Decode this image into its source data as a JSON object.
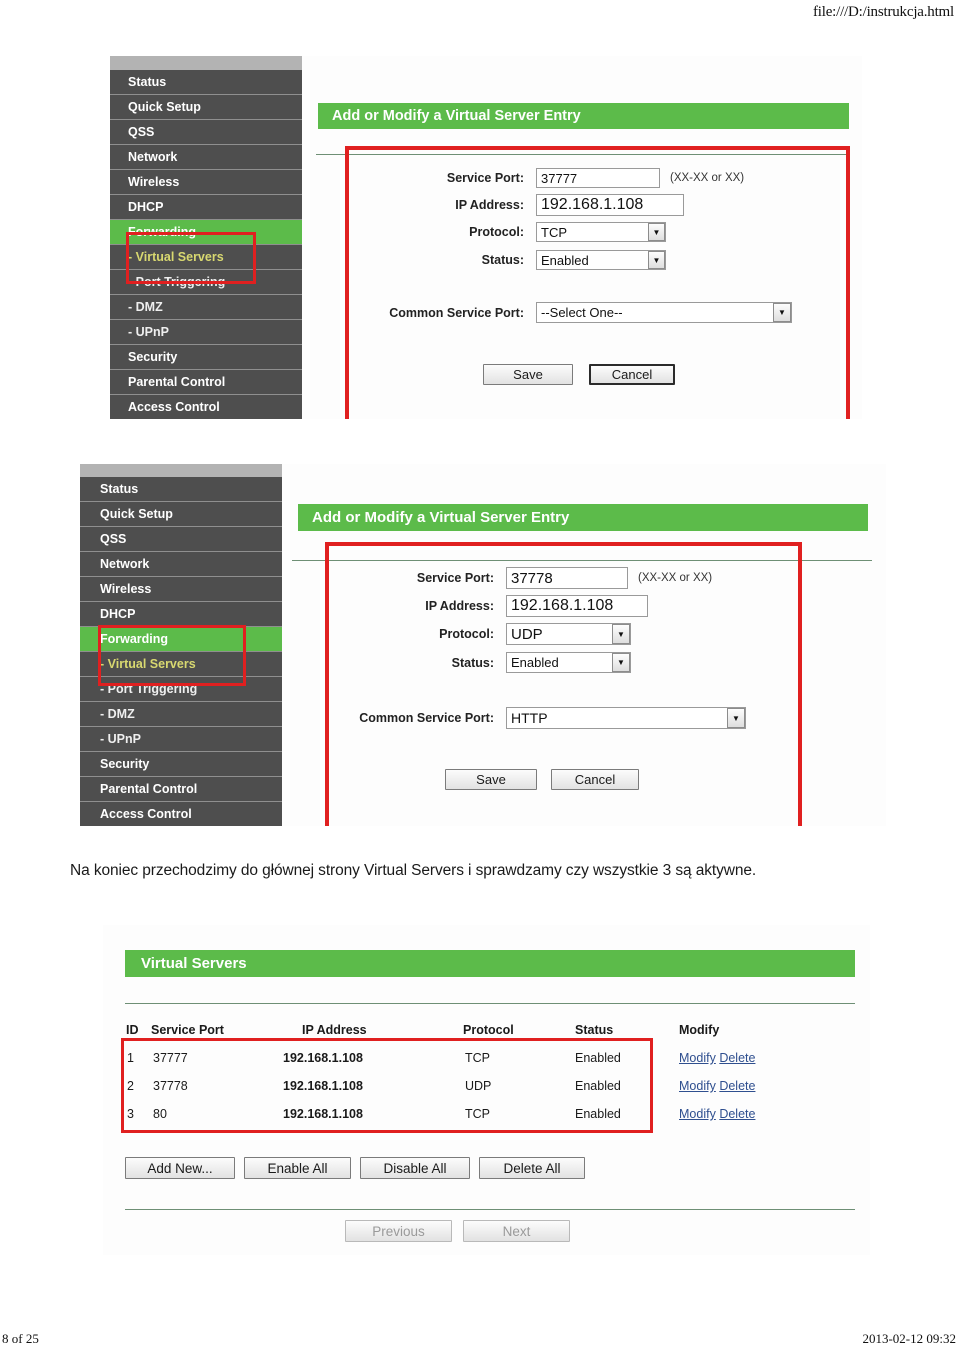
{
  "document": {
    "header_path": "file:///D:/instrukcja.html",
    "footer_page": "8 of 25",
    "footer_timestamp": "2013-02-12 09:32",
    "paragraph": "Na koniec przechodzimy do głównej strony Virtual Servers i sprawdzamy czy wszystkie 3 są aktywne."
  },
  "colors": {
    "accent_green": "#5cbb4a",
    "sidebar_dark": "#4e4e4e",
    "annotation_red": "#e02020",
    "sub_item_highlight": "#d8d870"
  },
  "sidebar": {
    "items": [
      {
        "label": "Status",
        "type": "top"
      },
      {
        "label": "Quick Setup",
        "type": "top"
      },
      {
        "label": "QSS",
        "type": "top"
      },
      {
        "label": "Network",
        "type": "top"
      },
      {
        "label": "Wireless",
        "type": "top"
      },
      {
        "label": "DHCP",
        "type": "top"
      },
      {
        "label": "Forwarding",
        "type": "active"
      },
      {
        "label": "- Virtual Servers",
        "type": "active-sub"
      },
      {
        "label": "- Port Triggering",
        "type": "sub"
      },
      {
        "label": "- DMZ",
        "type": "sub"
      },
      {
        "label": "- UPnP",
        "type": "sub"
      },
      {
        "label": "Security",
        "type": "top"
      },
      {
        "label": "Parental Control",
        "type": "top"
      },
      {
        "label": "Access Control",
        "type": "top"
      }
    ]
  },
  "screenshot_one": {
    "panel_title": "Add or Modify a Virtual Server Entry",
    "fields": {
      "service_port_label": "Service Port:",
      "service_port_value": "37777",
      "service_port_hint": "(XX-XX or XX)",
      "ip_address_label": "IP Address:",
      "ip_address_value": "192.168.1.108",
      "protocol_label": "Protocol:",
      "protocol_value": "TCP",
      "status_label": "Status:",
      "status_value": "Enabled",
      "common_port_label": "Common Service Port:",
      "common_port_value": "--Select One--"
    },
    "buttons": {
      "save": "Save",
      "cancel": "Cancel"
    }
  },
  "screenshot_two": {
    "panel_title": "Add or Modify a Virtual Server Entry",
    "fields": {
      "service_port_label": "Service Port:",
      "service_port_value": "37778",
      "service_port_hint": "(XX-XX or XX)",
      "ip_address_label": "IP Address:",
      "ip_address_value": "192.168.1.108",
      "protocol_label": "Protocol:",
      "protocol_value": "UDP",
      "status_label": "Status:",
      "status_value": "Enabled",
      "common_port_label": "Common Service Port:",
      "common_port_value": "HTTP"
    },
    "buttons": {
      "save": "Save",
      "cancel": "Cancel"
    }
  },
  "screenshot_three": {
    "panel_title": "Virtual Servers",
    "table": {
      "headers": [
        "ID",
        "Service Port",
        "IP Address",
        "Protocol",
        "Status",
        "Modify"
      ],
      "rows": [
        {
          "id": "1",
          "service_port": "37777",
          "ip_address": "192.168.1.108",
          "protocol": "TCP",
          "status": "Enabled",
          "modify": "Modify",
          "delete": "Delete"
        },
        {
          "id": "2",
          "service_port": "37778",
          "ip_address": "192.168.1.108",
          "protocol": "UDP",
          "status": "Enabled",
          "modify": "Modify",
          "delete": "Delete"
        },
        {
          "id": "3",
          "service_port": "80",
          "ip_address": "192.168.1.108",
          "protocol": "TCP",
          "status": "Enabled",
          "modify": "Modify",
          "delete": "Delete"
        }
      ]
    },
    "buttons": {
      "add_new": "Add New...",
      "enable_all": "Enable All",
      "disable_all": "Disable All",
      "delete_all": "Delete All",
      "previous": "Previous",
      "next": "Next"
    }
  }
}
